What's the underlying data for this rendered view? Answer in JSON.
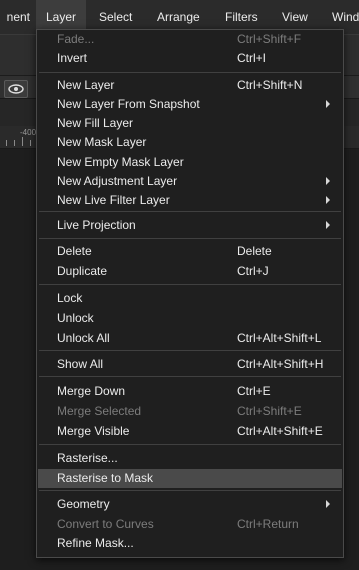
{
  "menubar": {
    "items": [
      {
        "label": "nent"
      },
      {
        "label": "Layer"
      },
      {
        "label": "Select"
      },
      {
        "label": "Arrange"
      },
      {
        "label": "Filters"
      },
      {
        "label": "View"
      },
      {
        "label": "Wind"
      }
    ]
  },
  "ruler": {
    "label": "-400"
  },
  "layer_menu": {
    "items": [
      {
        "label": "Fade...",
        "shortcut": "Ctrl+Shift+F",
        "disabled": true
      },
      {
        "label": "Invert",
        "shortcut": "Ctrl+I"
      },
      {
        "label": "New Layer",
        "shortcut": "Ctrl+Shift+N"
      },
      {
        "label": "New Layer From Snapshot",
        "submenu": true
      },
      {
        "label": "New Fill Layer"
      },
      {
        "label": "New Mask Layer"
      },
      {
        "label": "New Empty Mask Layer"
      },
      {
        "label": "New Adjustment Layer",
        "submenu": true
      },
      {
        "label": "New Live Filter Layer",
        "submenu": true
      },
      {
        "label": "Live Projection",
        "submenu": true
      },
      {
        "label": "Delete",
        "shortcut": "Delete"
      },
      {
        "label": "Duplicate",
        "shortcut": "Ctrl+J"
      },
      {
        "label": "Lock"
      },
      {
        "label": "Unlock"
      },
      {
        "label": "Unlock All",
        "shortcut": "Ctrl+Alt+Shift+L"
      },
      {
        "label": "Show All",
        "shortcut": "Ctrl+Alt+Shift+H"
      },
      {
        "label": "Merge Down",
        "shortcut": "Ctrl+E"
      },
      {
        "label": "Merge Selected",
        "shortcut": "Ctrl+Shift+E",
        "disabled": true
      },
      {
        "label": "Merge Visible",
        "shortcut": "Ctrl+Alt+Shift+E"
      },
      {
        "label": "Rasterise..."
      },
      {
        "label": "Rasterise to Mask",
        "highlighted": true
      },
      {
        "label": "Geometry",
        "submenu": true
      },
      {
        "label": "Convert to Curves",
        "shortcut": "Ctrl+Return",
        "disabled": true
      },
      {
        "label": "Refine Mask..."
      }
    ]
  }
}
